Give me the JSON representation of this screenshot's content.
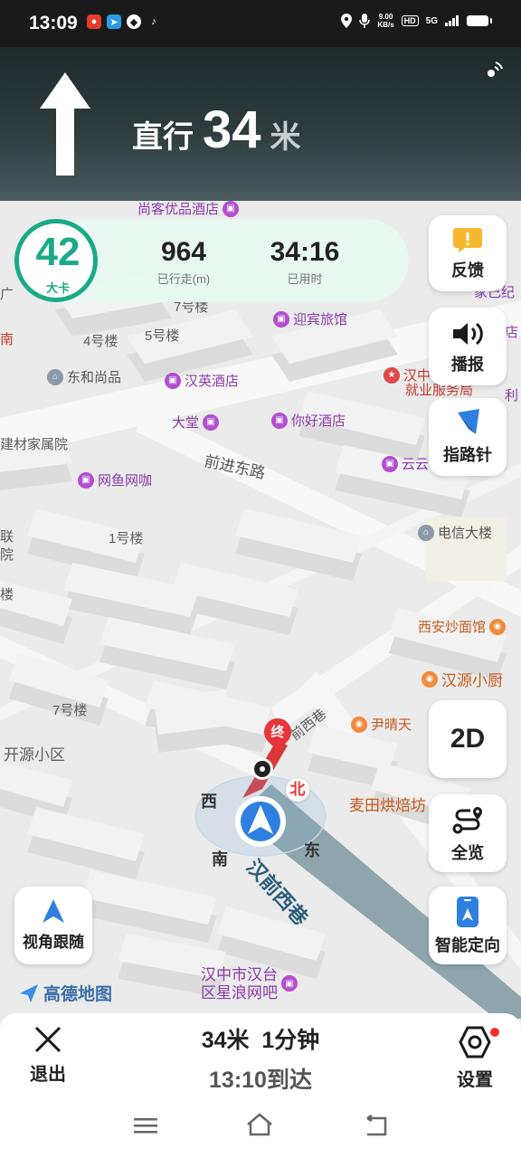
{
  "status_bar": {
    "time": "13:09",
    "speed_top": "9.00",
    "speed_unit": "KB/s",
    "hd": "HD",
    "signal": "5G"
  },
  "guidance": {
    "action": "直行",
    "distance": "34",
    "unit": "米"
  },
  "trip": {
    "speed": "42",
    "speed_unit": "大卡",
    "traveled": "964",
    "traveled_label": "已行走(m)",
    "elapsed": "34:16",
    "elapsed_label": "已用时"
  },
  "side_buttons": {
    "feedback": "反馈",
    "broadcast": "播报",
    "compass": "指路针",
    "view_mode": "2D",
    "overview": "全览",
    "locate": "智能定向"
  },
  "follow_button": "视角跟随",
  "map_logo": "高德地图",
  "map": {
    "roads": [
      "前进东路",
      "汉前西巷"
    ],
    "destination": "终",
    "directions": {
      "north": "北",
      "south": "南",
      "east": "东",
      "west": "西"
    },
    "labels": [
      "尚客优品酒店",
      "广",
      "7号楼",
      "4号楼",
      "5号楼",
      "迎宾旅馆",
      "店",
      "南",
      "东和尚品",
      "汉英酒店",
      "汉中",
      "就业服务局",
      "利",
      "家己纪",
      "大堂",
      "你好酒店",
      "建材家属院",
      "云云",
      "网鱼网咖",
      "联",
      "院",
      "1号楼",
      "电信大楼",
      "楼",
      "西安炒面馆",
      "汉源小厨",
      "7号楼",
      "开源小区",
      "前西巷",
      "尹晴天",
      "麦田烘焙坊",
      "汉中市汉台",
      "区星浪网吧"
    ]
  },
  "bottom": {
    "exit": "退出",
    "remaining": "34米  1分钟",
    "arrival": "13:10到达",
    "settings": "设置"
  }
}
